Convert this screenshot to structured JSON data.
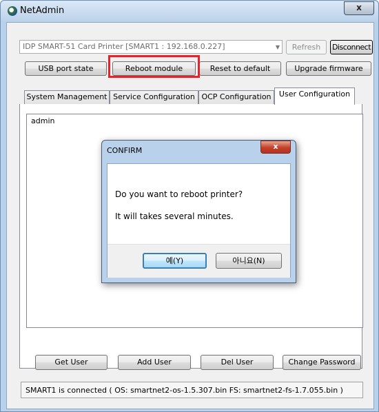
{
  "window": {
    "title": "NetAdmin",
    "close_glyph": "x"
  },
  "device": {
    "selected": "IDP SMART-51 Card Printer  [SMART1 : 192.168.0.227]",
    "refresh_label": "Refresh",
    "disconnect_label": "Disconnect"
  },
  "actions": {
    "usb_port_state": "USB port state",
    "reboot_module": "Reboot module",
    "reset_default": "Reset to default",
    "upgrade_firmware": "Upgrade firmware"
  },
  "tabs": [
    {
      "label": "System Management"
    },
    {
      "label": "Service Configuration"
    },
    {
      "label": "OCP Configuration"
    },
    {
      "label": "User Configuration"
    }
  ],
  "users": [
    "admin"
  ],
  "user_buttons": {
    "get_user": "Get User",
    "add_user": "Add User",
    "del_user": "Del User",
    "change_password": "Change Password"
  },
  "status": {
    "text": "SMART1 is connected ( OS: smartnet2-os-1.5.307.bin  FS: smartnet2-fs-1.7.055.bin )"
  },
  "dialog": {
    "title": "CONFIRM",
    "close_glyph": "x",
    "message_1": "Do you want to reboot printer?",
    "message_2": "It will takes several minutes.",
    "yes_label": "예(Y)",
    "no_label": "아니요(N)"
  },
  "colors": {
    "highlight_box": "#e8212a",
    "accent": "#3c7fb1"
  }
}
